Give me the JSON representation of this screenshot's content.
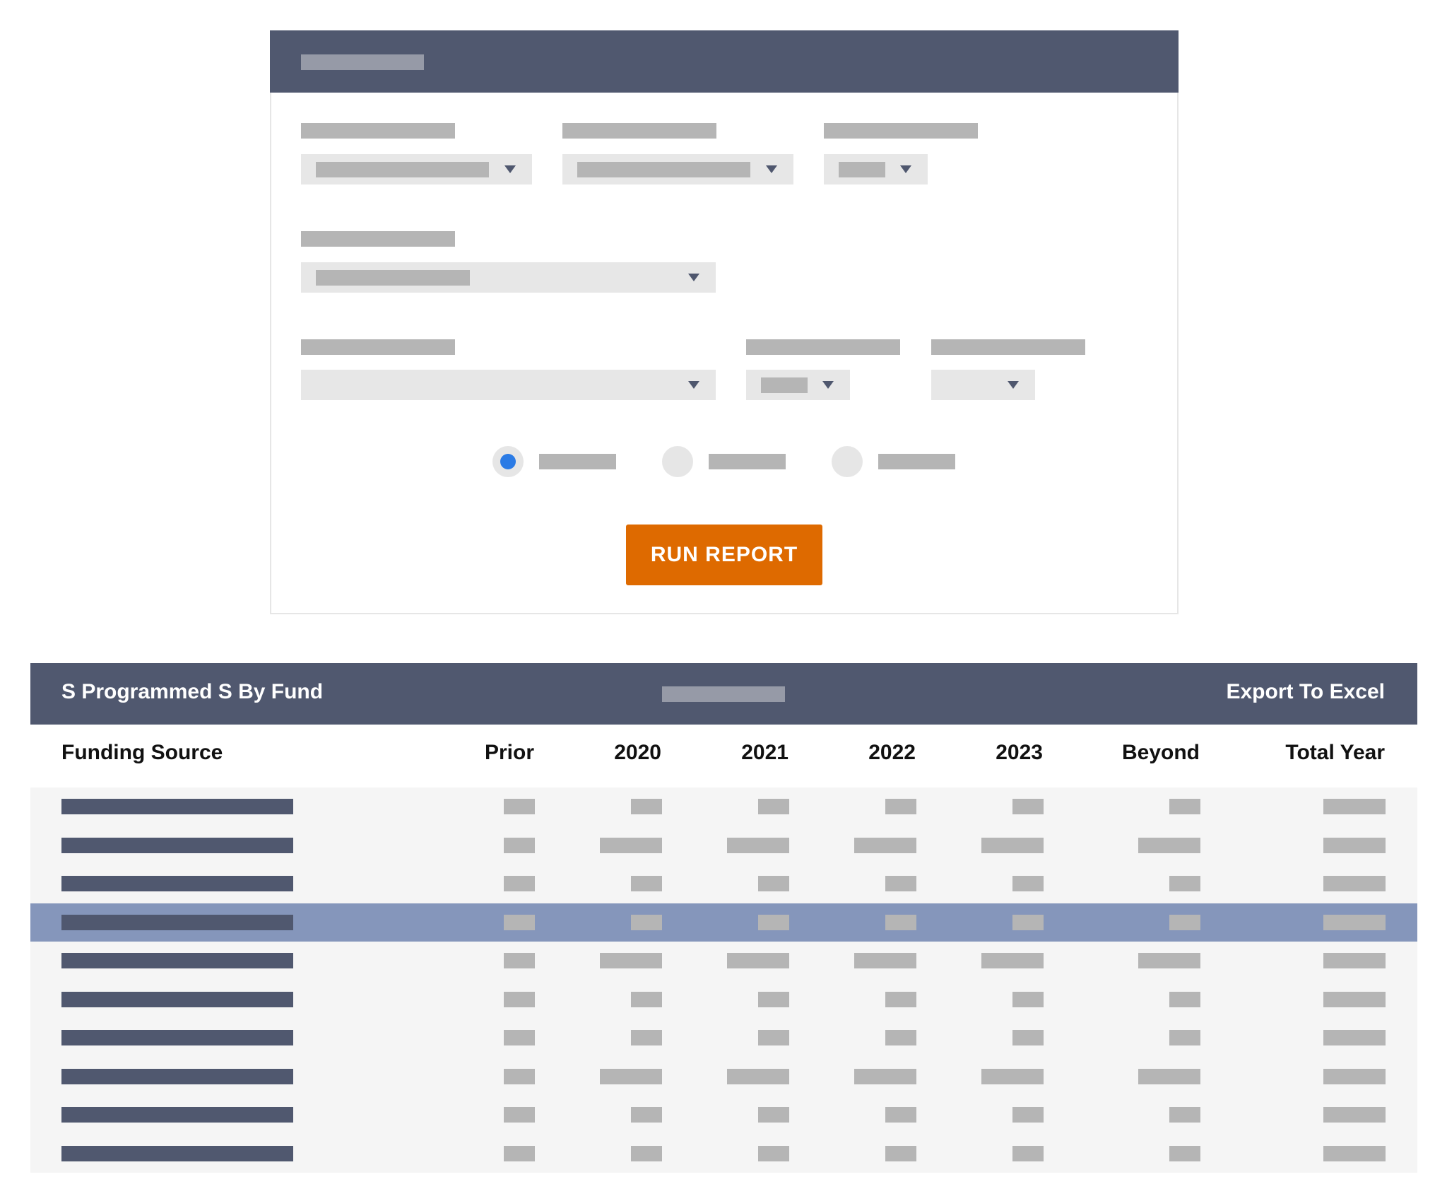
{
  "form": {
    "run_button_label": "RUN REPORT",
    "selected_radio": 0
  },
  "table": {
    "title": "S Programmed S By Fund",
    "export_label": "Export To Excel",
    "columns": [
      "Funding Source",
      "Prior",
      "2020",
      "2021",
      "2022",
      "2023",
      "Beyond",
      "Total Year"
    ],
    "selected_row": 3,
    "row_count": 10
  },
  "colors": {
    "header": "#50586f",
    "accent_button": "#de6a00",
    "radio_selected": "#2b7be5",
    "selected_row": "#8596bb"
  },
  "icons": [
    "chevron-down-icon",
    "radio-dot-icon"
  ]
}
